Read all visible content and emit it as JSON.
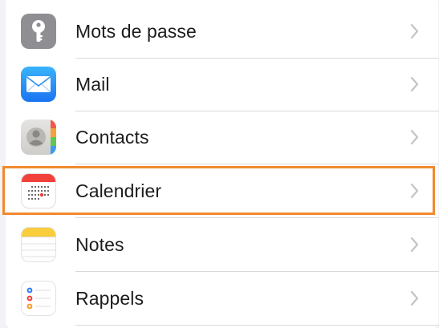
{
  "settings": {
    "items": [
      {
        "label": "Mots de passe",
        "icon": "key-icon"
      },
      {
        "label": "Mail",
        "icon": "envelope-icon"
      },
      {
        "label": "Contacts",
        "icon": "contacts-card-icon"
      },
      {
        "label": "Calendrier",
        "icon": "calendar-icon",
        "highlighted": true
      },
      {
        "label": "Notes",
        "icon": "notes-icon"
      },
      {
        "label": "Rappels",
        "icon": "reminders-list-icon"
      }
    ]
  },
  "colors": {
    "highlight": "#f08a2e",
    "chevron": "#c4c4c7",
    "label": "#1c1c1e",
    "background": "#f2f2f7"
  }
}
